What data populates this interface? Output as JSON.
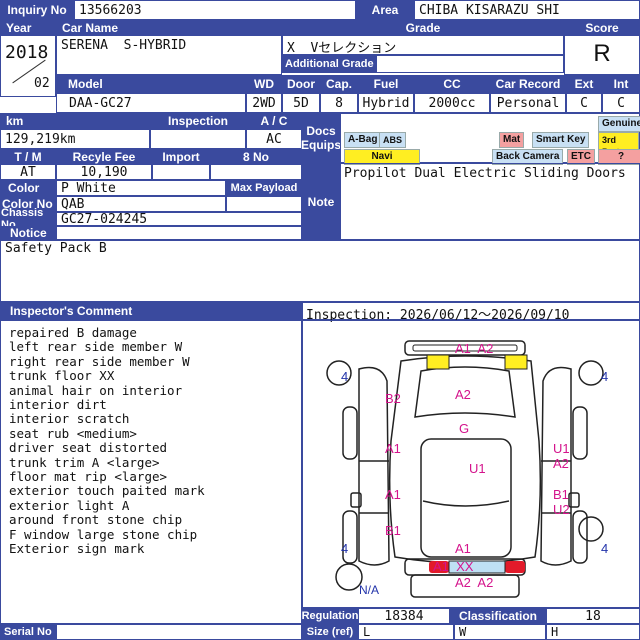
{
  "header": {
    "inquiry_label": "Inquiry No",
    "inquiry_no": "13566203",
    "area_label": "Area",
    "area": "CHIBA KISARAZU SHI"
  },
  "row_labels": {
    "year": "Year",
    "car_name": "Car Name",
    "grade": "Grade",
    "score": "Score",
    "additional_grade": "Additional Grade",
    "model": "Model",
    "wd": "WD",
    "door": "Door",
    "cap": "Cap.",
    "fuel": "Fuel",
    "cc": "CC",
    "car_record": "Car Record",
    "ext": "Ext",
    "int": "Int",
    "km": "km",
    "inspection": "Inspection",
    "ac": "A / C",
    "docs": "Docs",
    "equips": "Equips",
    "tm": "T / M",
    "recycle_fee": "Recyle Fee",
    "import": "Import",
    "eight_no": "8 No",
    "color": "Color",
    "max_payload": "Max Payload",
    "color_no": "Color No",
    "chassis_no": "Chassis No",
    "notice": "Notice",
    "note": "Note",
    "inspector_comment": "Inspector's Comment",
    "regulation": "Regulation",
    "classification": "Classification",
    "serial_no": "Serial No",
    "size_ref": "Size (ref)"
  },
  "vehicle": {
    "year": "2018",
    "month": "02",
    "car_name": "SERENA  S-HYBRID",
    "grade": "X  Vセレクション",
    "score": "R",
    "model": "DAA-GC27",
    "wd": "2WD",
    "door": "5D",
    "cap": "8",
    "fuel": "Hybrid",
    "cc": "2000cc",
    "car_record": "Personal",
    "ext": "C",
    "int": "C",
    "km": "129,219km",
    "ac": "AC",
    "tm": "AT",
    "recycle_fee": "10,190",
    "color": "P White",
    "color_no": "QAB",
    "chassis_no": "GC27-024245"
  },
  "equips": {
    "abag": "A-Bag",
    "abs": "ABS",
    "mat": "Mat",
    "smart_key": "Smart Key",
    "genuine": "Genuine",
    "third_party": "3rd Party",
    "navi": "Navi",
    "back_camera": "Back Camera",
    "etc": "ETC",
    "question": "?"
  },
  "note_text": "Propilot Dual Electric Sliding Doors",
  "notice_text": "Safety Pack B",
  "inspection_period": "Inspection: 2026/06/12〜2026/09/10",
  "comments": [
    "repaired B damage",
    "left rear side member W",
    "right rear side member W",
    "trunk floor XX",
    "animal hair on interior",
    "interior dirt",
    "interior scratch",
    "seat rub <medium>",
    "driver seat distorted",
    "trunk trim A <large>",
    "floor mat rip <large>",
    "exterior touch paited mark",
    "exterior light A",
    "around front stone chip",
    "F window large stone chip",
    "Exterior sign mark"
  ],
  "footer": {
    "regulation": "18384",
    "classification": "18",
    "size_l": "L",
    "size_w": "W",
    "size_h": "H"
  },
  "damage_marks": {
    "rear_top": "A1  A2",
    "b2": "B2",
    "a2_rear": "A2",
    "g": "G",
    "a1_left": "A1",
    "u1_right": "U1",
    "a2_right": "A2",
    "u1_center": "U1",
    "a1_left2": "A1",
    "b1_right": "B1",
    "u2_right": "U2",
    "b1_left": "B1",
    "a1_front": "A1",
    "front_row": "A1  XX",
    "front_a2": "A2  A2",
    "tire_rl": "4",
    "tire_rr": "4",
    "tire_fl": "4",
    "tire_fr": "4",
    "spare": "N/A"
  },
  "colors": {
    "header_bg": "#3a4a9e",
    "mark_pink": "#d4148c",
    "navi_yellow": "#ffee22",
    "mat_red": "#f4a0a0",
    "equip_blue": "#c8e0f4"
  }
}
